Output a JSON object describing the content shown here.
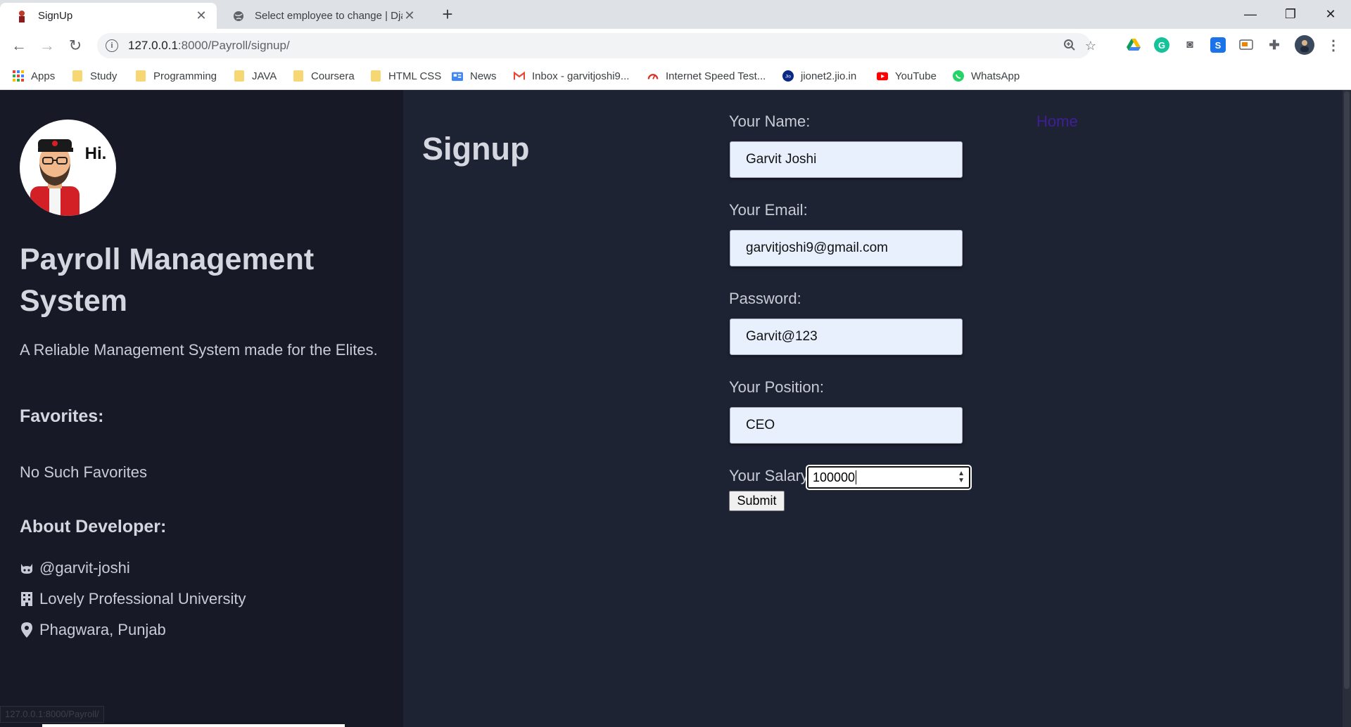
{
  "browser": {
    "tabs": [
      {
        "title": "SignUp",
        "active": true
      },
      {
        "title": "Select employee to change | Djan",
        "active": false
      }
    ],
    "new_tab_label": "+",
    "url_host": "127.0.0.1",
    "url_path": ":8000/Payroll/signup/",
    "bookmarks": [
      {
        "label": "Apps",
        "icon": "apps-grid-icon"
      },
      {
        "label": "Study",
        "icon": "folder-icon"
      },
      {
        "label": "Programming",
        "icon": "folder-icon"
      },
      {
        "label": "JAVA",
        "icon": "folder-icon"
      },
      {
        "label": "Coursera",
        "icon": "folder-icon"
      },
      {
        "label": "HTML CSS",
        "icon": "folder-icon"
      },
      {
        "label": "News",
        "icon": "google-news-icon"
      },
      {
        "label": "Inbox - garvitjoshi9...",
        "icon": "gmail-icon"
      },
      {
        "label": "Internet Speed Test...",
        "icon": "speedometer-icon"
      },
      {
        "label": "jionet2.jio.in",
        "icon": "jio-icon"
      },
      {
        "label": "YouTube",
        "icon": "youtube-icon"
      },
      {
        "label": "WhatsApp",
        "icon": "whatsapp-icon"
      }
    ]
  },
  "sidebar": {
    "avatar_text": "Hi.",
    "site_title": "Payroll Management System",
    "tagline": "A Reliable Management System made for the Elites.",
    "favorites_heading": "Favorites:",
    "favorites_empty": "No Such Favorites",
    "about_heading": "About Developer:",
    "about_items": [
      {
        "text": "@garvit-joshi",
        "icon": "github-icon"
      },
      {
        "text": "Lovely Professional University",
        "icon": "building-icon"
      },
      {
        "text": "Phagwara, Punjab",
        "icon": "map-marker-icon"
      }
    ]
  },
  "main": {
    "heading": "Signup",
    "home_link": "Home",
    "form": {
      "name_label": "Your Name:",
      "name_value": "Garvit Joshi",
      "email_label": "Your Email:",
      "email_value": "garvitjoshi9@gmail.com",
      "password_label": "Password:",
      "password_value": "Garvit@123",
      "position_label": "Your Position:",
      "position_value": "CEO",
      "salary_label": "Your Salary:",
      "salary_value": "100000",
      "submit_label": "Submit"
    }
  },
  "status_bar_url": "127.0.0.1:8000/Payroll/",
  "colors": {
    "sidebar_bg": "#171926",
    "content_bg": "#1e2334",
    "home_link": "#3f1e96"
  }
}
